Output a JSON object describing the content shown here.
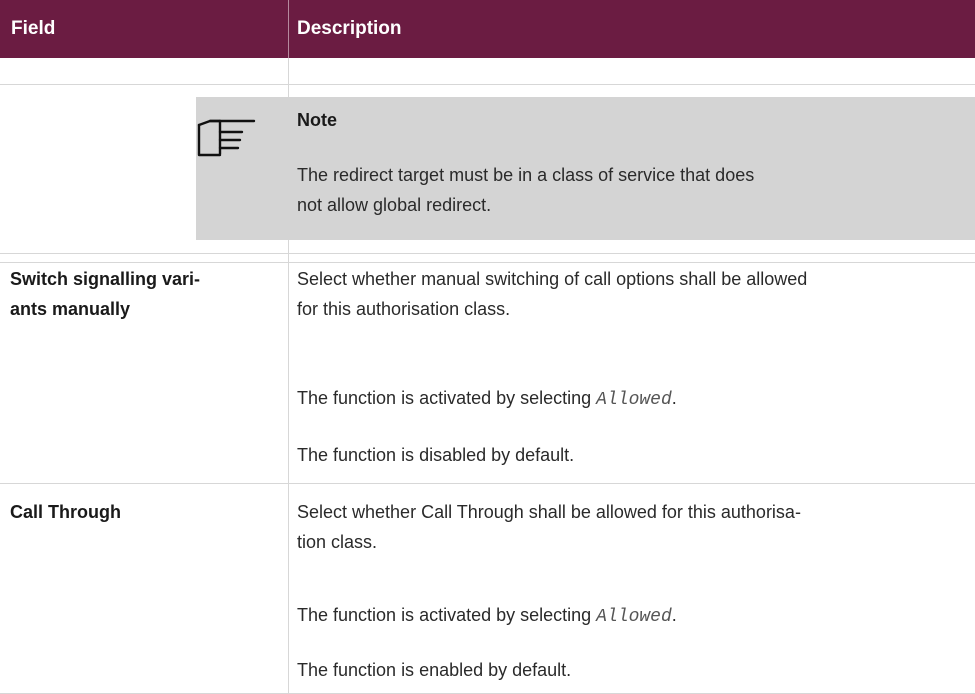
{
  "table": {
    "header": {
      "field": "Field",
      "description": "Description"
    }
  },
  "note": {
    "title": "Note",
    "text_line1": "The redirect target must be in a class of service that does",
    "text_line2": "not allow global redirect.",
    "icon": "pointing-hand-icon"
  },
  "rows": [
    {
      "field_line1": "Switch signalling vari-",
      "field_line2": "ants manually",
      "desc_line1": "Select whether manual switching of call options shall be allowed",
      "desc_line2": "for this authorisation class.",
      "activated_prefix": "The function is activated by selecting ",
      "activated_value": "Allowed",
      "activated_suffix": ".",
      "default_text": "The function is disabled by default."
    },
    {
      "field_line1": "Call Through",
      "desc_line1": "Select whether Call Through shall be allowed for this authorisa-",
      "desc_line2": "tion class.",
      "activated_prefix": "The function is activated by selecting ",
      "activated_value": "Allowed",
      "activated_suffix": ".",
      "default_text": "The function is enabled by default."
    }
  ],
  "colors": {
    "header_bg": "#6b1c42",
    "note_bg": "#d4d4d4",
    "grid": "#d7d7d7"
  }
}
